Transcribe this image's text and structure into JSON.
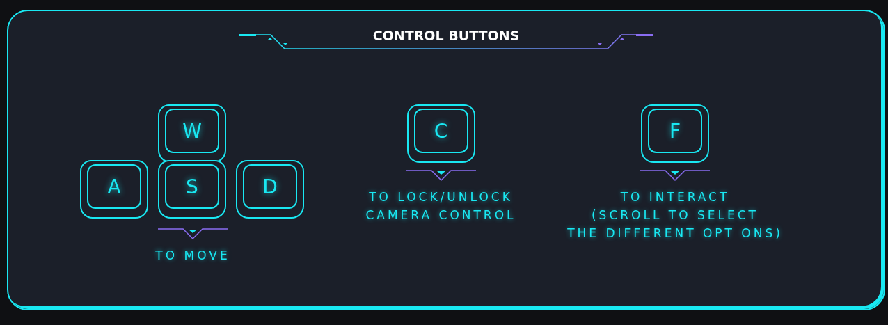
{
  "title": "CONTROL BUTTONS",
  "groups": [
    {
      "kind": "wasd",
      "keys": [
        "W",
        "A",
        "S",
        "D"
      ],
      "caption": [
        "TO MOVE"
      ]
    },
    {
      "kind": "single",
      "keys": [
        "C"
      ],
      "caption": [
        "TO LOCK/UNLOCK",
        "CAMERA CONTROL"
      ]
    },
    {
      "kind": "single",
      "keys": [
        "F"
      ],
      "caption": [
        "TO INTERACT",
        "(SCROLL TO SELECT",
        "THE DIFFERENT OPT ONS)"
      ]
    }
  ]
}
